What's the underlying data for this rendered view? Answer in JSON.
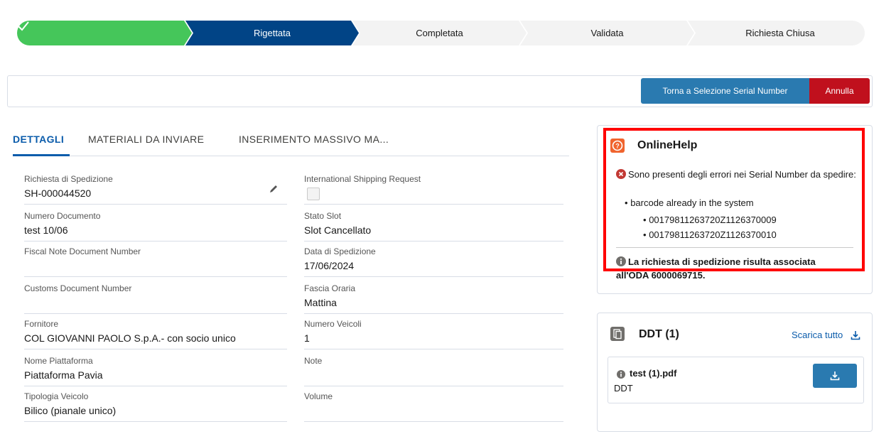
{
  "path": {
    "steps": [
      {
        "label": "",
        "state": "completed"
      },
      {
        "label": "Rigettata",
        "state": "current"
      },
      {
        "label": "Completata",
        "state": "incomplete"
      },
      {
        "label": "Validata",
        "state": "incomplete"
      },
      {
        "label": "Richiesta Chiusa",
        "state": "incomplete"
      }
    ],
    "colors": {
      "completed": "#45c65a",
      "current": "#014486",
      "incomplete": "#f3f3f3"
    }
  },
  "actions": {
    "back_label": "Torna a Selezione Serial Number",
    "cancel_label": "Annulla"
  },
  "tabs": [
    {
      "label": "DETTAGLI"
    },
    {
      "label": "MATERIALI DA INVIARE"
    },
    {
      "label": "INSERIMENTO MASSIVO MA..."
    }
  ],
  "fields": {
    "left": [
      {
        "label": "Richiesta di Spedizione",
        "value": "SH-000044520"
      },
      {
        "label": "Numero Documento",
        "value": "test 10/06"
      },
      {
        "label": "Fiscal Note Document Number",
        "value": ""
      },
      {
        "label": "Customs Document Number",
        "value": ""
      },
      {
        "label": "Fornitore",
        "value": "COL GIOVANNI PAOLO S.p.A.- con socio unico"
      },
      {
        "label": "Nome Piattaforma",
        "value": "Piattaforma Pavia"
      },
      {
        "label": "Tipologia Veicolo",
        "value": "Bilico (pianale unico)"
      }
    ],
    "right": [
      {
        "label": "International Shipping Request",
        "value": ""
      },
      {
        "label": "Stato Slot",
        "value": "Slot Cancellato"
      },
      {
        "label": "Data di Spedizione",
        "value": "17/06/2024"
      },
      {
        "label": "Fascia Oraria",
        "value": "Mattina"
      },
      {
        "label": "Numero Veicoli",
        "value": "1"
      },
      {
        "label": "Note",
        "value": ""
      },
      {
        "label": "Volume",
        "value": ""
      }
    ]
  },
  "online_help": {
    "title": "OnlineHelp",
    "error_text": "Sono presenti degli errori nei Serial Number da spedire:",
    "bullet_main": "barcode already in the system",
    "barcodes": [
      "00179811263720Z1126370009",
      "00179811263720Z1126370010"
    ],
    "info_text": "La richiesta di spedizione risulta associata all'ODA 6000069715."
  },
  "ddt": {
    "title": "DDT (1)",
    "download_all_label": "Scarica tutto",
    "file_name": "test (1).pdf",
    "file_type": "DDT"
  }
}
